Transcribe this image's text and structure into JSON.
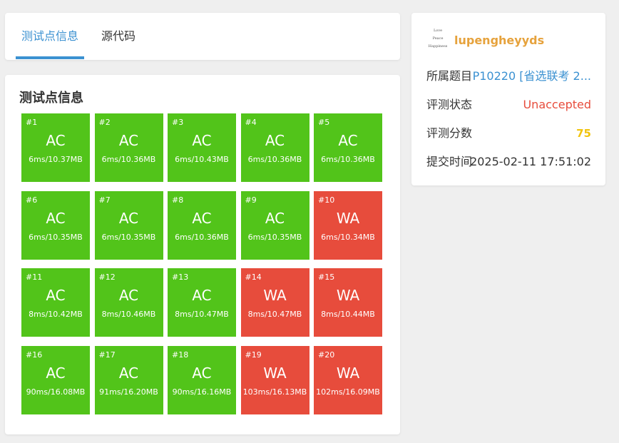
{
  "tabs": [
    {
      "label": "测试点信息",
      "active": true
    },
    {
      "label": "源代码",
      "active": false
    }
  ],
  "section_title": "测试点信息",
  "testcases": [
    {
      "id": "#1",
      "status": "AC",
      "info": "6ms/10.37MB"
    },
    {
      "id": "#2",
      "status": "AC",
      "info": "6ms/10.36MB"
    },
    {
      "id": "#3",
      "status": "AC",
      "info": "6ms/10.43MB"
    },
    {
      "id": "#4",
      "status": "AC",
      "info": "6ms/10.36MB"
    },
    {
      "id": "#5",
      "status": "AC",
      "info": "6ms/10.36MB"
    },
    {
      "id": "#6",
      "status": "AC",
      "info": "6ms/10.35MB"
    },
    {
      "id": "#7",
      "status": "AC",
      "info": "6ms/10.35MB"
    },
    {
      "id": "#8",
      "status": "AC",
      "info": "6ms/10.36MB"
    },
    {
      "id": "#9",
      "status": "AC",
      "info": "6ms/10.35MB"
    },
    {
      "id": "#10",
      "status": "WA",
      "info": "6ms/10.34MB"
    },
    {
      "id": "#11",
      "status": "AC",
      "info": "8ms/10.42MB"
    },
    {
      "id": "#12",
      "status": "AC",
      "info": "8ms/10.46MB"
    },
    {
      "id": "#13",
      "status": "AC",
      "info": "8ms/10.47MB"
    },
    {
      "id": "#14",
      "status": "WA",
      "info": "8ms/10.47MB"
    },
    {
      "id": "#15",
      "status": "WA",
      "info": "8ms/10.44MB"
    },
    {
      "id": "#16",
      "status": "AC",
      "info": "90ms/16.08MB"
    },
    {
      "id": "#17",
      "status": "AC",
      "info": "91ms/16.20MB"
    },
    {
      "id": "#18",
      "status": "AC",
      "info": "90ms/16.16MB"
    },
    {
      "id": "#19",
      "status": "WA",
      "info": "103ms/16.13MB"
    },
    {
      "id": "#20",
      "status": "WA",
      "info": "102ms/16.09MB"
    }
  ],
  "colors": {
    "ac": "#52c41a",
    "wa": "#e74c3c",
    "accent": "#3b91d1",
    "username": "#e6a23c",
    "score": "#f1c40f"
  },
  "sidebar": {
    "avatar_text": [
      "Love",
      "Peace",
      "Happiness"
    ],
    "username": "lupengheyyds",
    "problem_label": "所属题目",
    "problem_value": "P10220 [省选联考 2...",
    "status_label": "评测状态",
    "status_value": "Unaccepted",
    "score_label": "评测分数",
    "score_value": "75",
    "time_label": "提交时间",
    "time_value": "2025-02-11 17:51:02"
  }
}
